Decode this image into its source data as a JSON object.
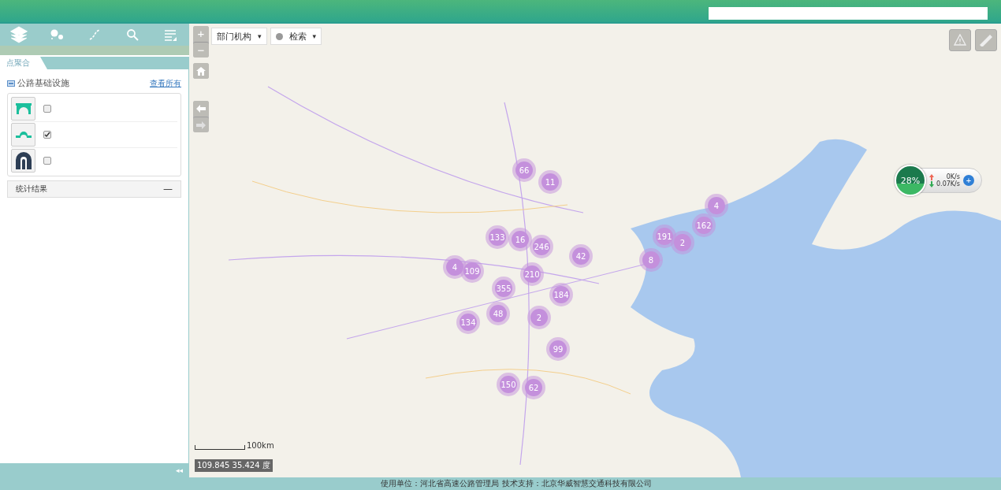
{
  "toolbar": {
    "tools": [
      {
        "kind": "layers"
      },
      {
        "kind": "cluster"
      },
      {
        "kind": "measure"
      },
      {
        "kind": "search"
      },
      {
        "kind": "list"
      }
    ]
  },
  "panel": {
    "tab": {
      "label": "点聚合",
      "selected": true
    },
    "section": {
      "title": "公路基础设施",
      "link": "查看所有"
    },
    "layers": [
      {
        "kind": "bridge",
        "checked": false
      },
      {
        "kind": "interchange",
        "checked": true
      },
      {
        "kind": "tunnel",
        "checked": false
      }
    ],
    "stats": {
      "title": "统计结果",
      "toggle": "—"
    },
    "collapse": "◂◂"
  },
  "map": {
    "controls": {
      "zoom_in": "+",
      "zoom_out": "−"
    },
    "dropdowns": [
      {
        "label": "部门机构",
        "caret": "▾"
      },
      {
        "label": "检索",
        "caret": "▾"
      }
    ],
    "clusters": [
      {
        "count": "66"
      },
      {
        "count": "11"
      },
      {
        "count": "133"
      },
      {
        "count": "16"
      },
      {
        "count": "246"
      },
      {
        "count": "42"
      },
      {
        "count": "8"
      },
      {
        "count": "191"
      },
      {
        "count": "2"
      },
      {
        "count": "162"
      },
      {
        "count": "4"
      },
      {
        "count": "4"
      },
      {
        "count": "109"
      },
      {
        "count": "210"
      },
      {
        "count": "355"
      },
      {
        "count": "184"
      },
      {
        "count": "48"
      },
      {
        "count": "2"
      },
      {
        "count": "134"
      },
      {
        "count": "99"
      },
      {
        "count": "150"
      },
      {
        "count": "62"
      }
    ],
    "network": {
      "percent": "28%",
      "upload": "0K/s",
      "download": "0.07K/s",
      "add": "+"
    },
    "scale": "100km",
    "coordinates": "109.845 35.424 度"
  },
  "footer": "使用单位：河北省高速公路管理局 技术支持：北京华威智慧交通科技有限公司"
}
